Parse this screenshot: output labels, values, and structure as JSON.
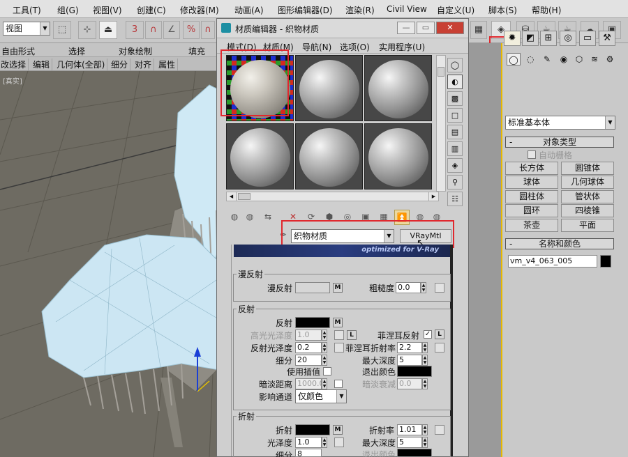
{
  "menubar": {
    "items": [
      "工具(T)",
      "组(G)",
      "视图(V)",
      "创建(C)",
      "修改器(M)",
      "动画(A)",
      "图形编辑器(D)",
      "渲染(R)",
      "Civil View",
      "自定义(U)",
      "脚本(S)",
      "帮助(H)"
    ]
  },
  "toolbar": {
    "viewport_select": "视图",
    "snap_label_3": "3"
  },
  "ribbon": {
    "row1": [
      "自由形式",
      "选择",
      "对象绘制",
      "填充"
    ],
    "row2": [
      "改选择",
      "编辑",
      "几何体(全部)",
      "细分",
      "对齐",
      "属性"
    ]
  },
  "viewport": {
    "label": "[真实]"
  },
  "material_editor": {
    "title": "材质编辑器 - 织物材质",
    "menu": [
      "模式(D)",
      "材质(M)",
      "导航(N)",
      "选项(O)",
      "实用程序(U)"
    ],
    "material_name": "织物材质",
    "material_type": "VRayMtl",
    "banner_text": "optimized for V-Ray",
    "diffuse": {
      "group": "漫反射",
      "label": "漫反射",
      "roughness_label": "粗糙度",
      "roughness": "0.0",
      "map_button": "M"
    },
    "reflect": {
      "group": "反射",
      "reflect_label": "反射",
      "hilight_gloss_label": "高光光泽度",
      "hilight_gloss": "1.0",
      "refl_gloss_label": "反射光泽度",
      "refl_gloss": "0.2",
      "subdivs_label": "细分",
      "subdivs": "20",
      "use_interp_label": "使用插值",
      "dim_distance_label": "暗淡距离",
      "dim_distance": "1000.0",
      "affect_channels_label": "影响通道",
      "affect_channels": "仅颜色",
      "fresnel_label": "菲涅耳反射",
      "fresnel_ior_label": "菲涅耳折射率",
      "fresnel_ior": "2.2",
      "max_depth_label": "最大深度",
      "max_depth": "5",
      "exit_color_label": "退出颜色",
      "dim_falloff_label": "暗淡衰减",
      "dim_falloff": "0.0",
      "fresnel_checked": "✓",
      "l_button": "L",
      "map_button": "M"
    },
    "refract": {
      "group": "折射",
      "refract_label": "折射",
      "gloss_label": "光泽度",
      "gloss": "1.0",
      "subdivs_label": "细分",
      "subdivs": "8",
      "ior_label": "折射率",
      "ior": "1.01",
      "max_depth_label": "最大深度",
      "max_depth": "5",
      "exit_color_label": "退出颜色",
      "map_button": "M"
    }
  },
  "command_panel": {
    "category": "标准基本体",
    "object_type_header": "对象类型",
    "autogrid_label": "自动栅格",
    "objects": [
      "长方体",
      "圆锥体",
      "球体",
      "几何球体",
      "圆柱体",
      "管状体",
      "圆环",
      "四棱锥",
      "茶壶",
      "平面"
    ],
    "name_color_header": "名称和颜色",
    "object_name": "vm_v4_063_005",
    "rollout_minus": "-"
  },
  "colors": {
    "highlight_red": "#e0282e",
    "panel_border_yellow": "#e6b800",
    "fabric_wire": "#cde7f4"
  }
}
